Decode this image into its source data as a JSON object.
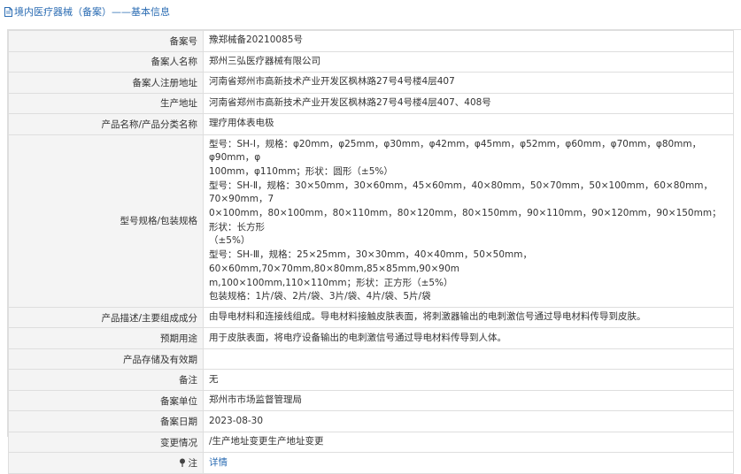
{
  "header": {
    "title": "境内医疗器械（备案）——基本信息"
  },
  "rows": {
    "record_no": {
      "label": "备案号",
      "value": "豫郑械备20210085号"
    },
    "applicant": {
      "label": "备案人名称",
      "value": "郑州三弘医疗器械有限公司"
    },
    "reg_address": {
      "label": "备案人注册地址",
      "value": "河南省郑州市高新技术产业开发区枫林路27号4号楼4层407"
    },
    "prod_address": {
      "label": "生产地址",
      "value": "河南省郑州市高新技术产业开发区枫林路27号4号楼4层407、408号"
    },
    "product_name": {
      "label": "产品名称/产品分类名称",
      "value": "理疗用体表电极"
    },
    "model_spec": {
      "label": "型号规格/包装规格",
      "lines": [
        "型号：SH-Ⅰ，规格：φ20mm，φ25mm，φ30mm，φ42mm，φ45mm，φ52mm，φ60mm，φ70mm，φ80mm，φ90mm，φ",
        "100mm，φ110mm；形状：圆形（±5%）",
        "型号：SH-Ⅱ，规格：30×50mm，30×60mm，45×60mm，40×80mm，50×70mm，50×100mm，60×80mm，70×90mm，7",
        "0×100mm，80×100mm，80×110mm，80×120mm，80×150mm，90×110mm，90×120mm，90×150mm；形状：长方形",
        "（±5%）",
        "型号：SH-Ⅲ，规格：25×25mm，30×30mm，40×40mm，50×50mm，60×60mm,70×70mm,80×80mm,85×85mm,90×90m",
        "m,100×100mm,110×110mm；形状：正方形（±5%）",
        "包装规格：1片/袋、2片/袋、3片/袋、4片/袋、5片/袋"
      ]
    },
    "description": {
      "label": "产品描述/主要组成成分",
      "value": "由导电材料和连接线组成。导电材料接触皮肤表面，将刺激器输出的电刺激信号通过导电材料传导到皮肤。"
    },
    "intended_use": {
      "label": "预期用途",
      "value": "用于皮肤表面，将电疗设备输出的电刺激信号通过导电材料传导到人体。"
    },
    "storage": {
      "label": "产品存储及有效期",
      "value": ""
    },
    "remarks": {
      "label": "备注",
      "value": "无"
    },
    "record_unit": {
      "label": "备案单位",
      "value": "郑州市市场监督管理局"
    },
    "record_date": {
      "label": "备案日期",
      "value": "2023-08-30"
    },
    "change": {
      "label": "变更情况",
      "value": "/生产地址变更生产地址变更"
    },
    "notes": {
      "label": "注",
      "value": "详情",
      "icon": "pin-icon"
    }
  },
  "colors": {
    "link": "#2b6cb3",
    "label_bg": "#f4f4f4",
    "border": "#dedede"
  }
}
